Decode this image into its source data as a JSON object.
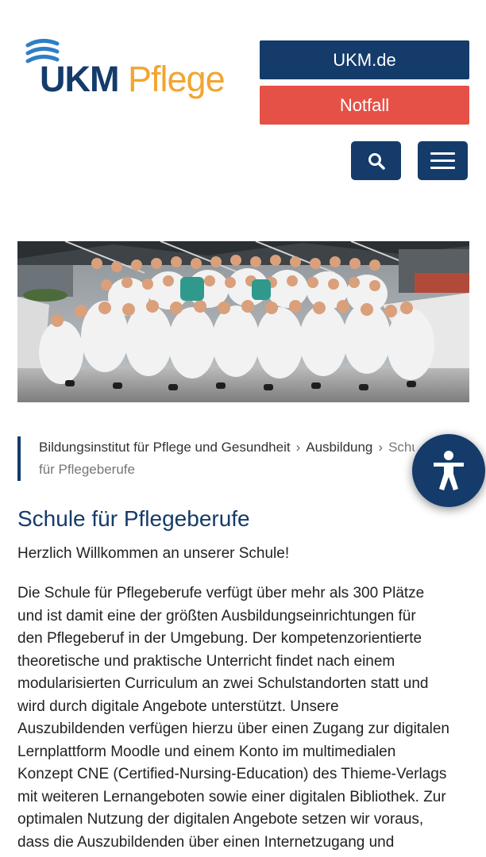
{
  "header": {
    "logo": {
      "brand": "UKM",
      "sub": "Pflege"
    },
    "ukm_button": "UKM.de",
    "notfall_button": "Notfall",
    "search_icon": "search-icon",
    "menu_icon": "hamburger-menu-icon"
  },
  "breadcrumb": {
    "items": [
      "Bildungsinstitut für Pflege und Gesundheit",
      "Ausbildung"
    ],
    "separator": "›",
    "current_part1": "Schule",
    "current_part2": "für Pflegeberufe"
  },
  "accessibility_button": {
    "icon": "accessibility-icon"
  },
  "main": {
    "title": "Schule für Pflegeberufe",
    "welcome": "Herzlich Willkommen an unserer Schule!",
    "intro_lines": [
      "Die Schule für Pflegeberufe verfügt über mehr als 300 Plätze",
      "und ist damit eine der größten Ausbildungseinrichtungen für",
      "den Pflegeberuf in der Umgebung. Der kompetenzorientierte",
      "theoretische und praktische Unterricht findet nach einem",
      "modularisierten Curriculum an zwei Schulstandorten statt und",
      "wird durch digitale Angebote unterstützt. Unsere",
      "Auszubildenden verfügen hierzu über einen Zugang zur digitalen",
      "Lernplattform Moodle und einem Konto im multimedialen",
      "Konzept CNE (Certified-Nursing-Education) des Thieme-Verlags",
      "mit weiteren Lernangeboten sowie einer digitalen Bibliothek. Zur",
      "optimalen Nutzung der digitalen Angebote setzen wir voraus,",
      "dass die Auszubildenden über einen Internetzugang und"
    ]
  },
  "colors": {
    "brand_blue": "#143b6a",
    "notfall_red": "#e55146",
    "logo_orange": "#f2a530",
    "logo_light_blue": "#2e7fc4"
  }
}
